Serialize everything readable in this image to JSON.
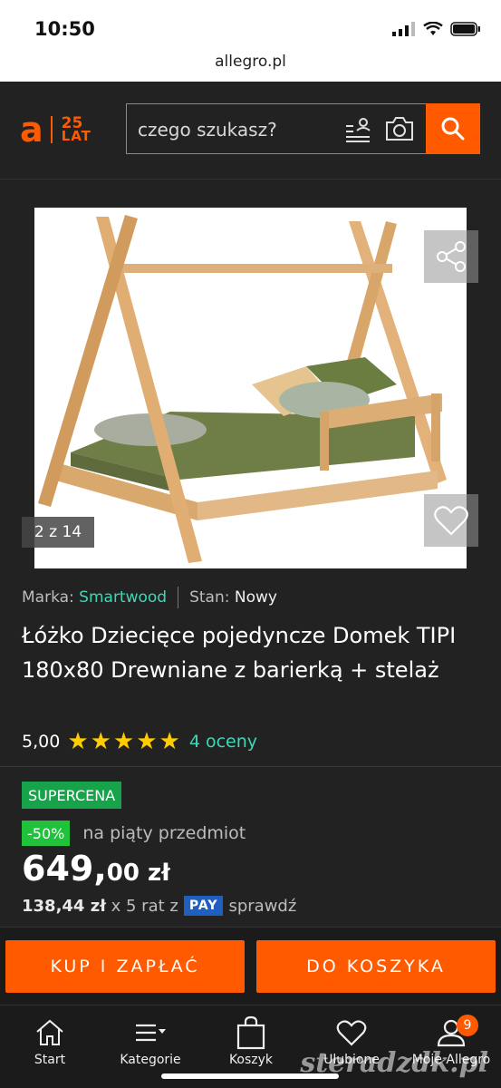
{
  "status_bar": {
    "time": "10:50",
    "url": "allegro.pl"
  },
  "header": {
    "logo_letter": "a",
    "logo_anniv_top": "25",
    "logo_anniv_bottom": "LAT",
    "search_placeholder": "czego szukasz?"
  },
  "gallery": {
    "counter": "2 z 14"
  },
  "product": {
    "brand_label": "Marka:",
    "brand_value": "Smartwood",
    "condition_label": "Stan:",
    "condition_value": "Nowy",
    "title": "Łóżko Dziecięce pojedyncze Domek TIPI 180x80 Drewniane z barierką + stelaż",
    "rating_value": "5,00",
    "rating_stars": 5,
    "rating_count": "4 oceny"
  },
  "offer": {
    "badge": "SUPERCENA",
    "discount": "-50%",
    "discount_text": "na piąty przedmiot",
    "price_main": "649,",
    "price_cents": "00 zł",
    "installment_amount": "138,44 zł",
    "installment_text": "x 5 rat z",
    "pay_label": "PAY",
    "installment_check": "sprawdź"
  },
  "actions": {
    "buy_label": "KUP I ZAPŁAĆ",
    "cart_label": "DO KOSZYKA"
  },
  "nav": {
    "items": [
      {
        "label": "Start",
        "icon": "home-icon"
      },
      {
        "label": "Kategorie",
        "icon": "menu-icon"
      },
      {
        "label": "Koszyk",
        "icon": "bag-icon"
      },
      {
        "label": "Ulubione",
        "icon": "heart-icon"
      },
      {
        "label": "Moje Allegro",
        "icon": "user-icon",
        "badge": "9"
      }
    ]
  },
  "watermark": "steradzdk.pl",
  "colors": {
    "accent": "#ff5a00",
    "link": "#3ed8b7",
    "background": "#222222"
  }
}
